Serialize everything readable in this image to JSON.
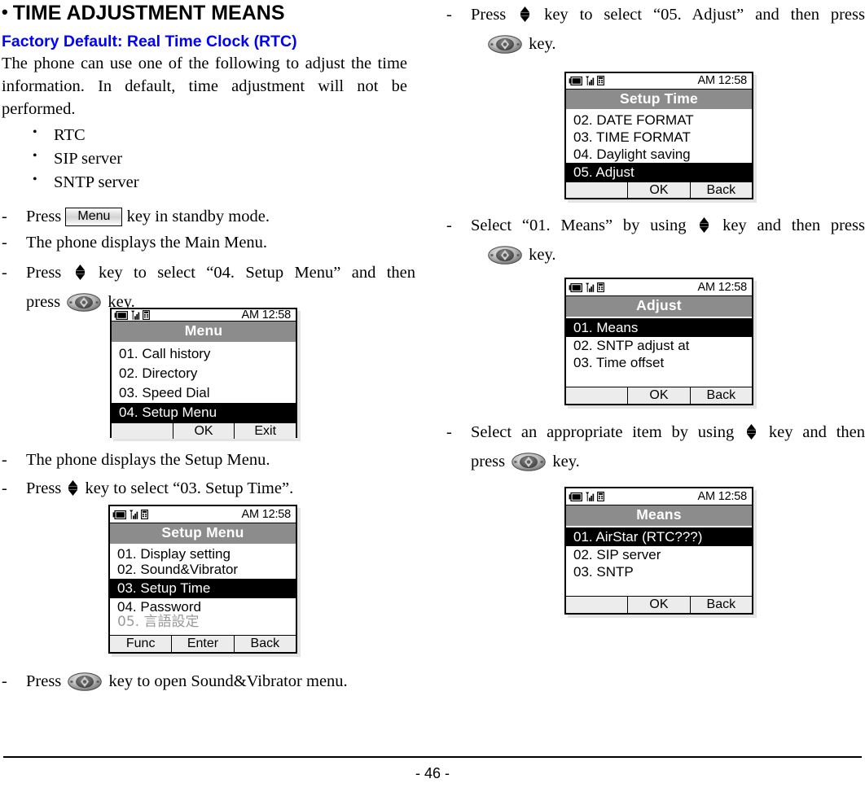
{
  "document": {
    "title": "TIME ADJUSTMENT MEANS",
    "bullet_glyph": "•",
    "subheading": "Factory Default: Real Time Clock (RTC)",
    "intro_paragraph": "The phone can use one of the following to adjust the time information. In default, time adjustment will not be performed.",
    "intro_bullets": [
      "RTC",
      "SIP server",
      "SNTP server"
    ],
    "page_number": "- 46 -"
  },
  "icons": {
    "battery": "battery-icon",
    "signal": "signal-bars-icon",
    "handset": "handset-icon",
    "updown": "up-down-arrow-key-icon",
    "navkey": "navigation-key-icon",
    "menukey": "menu-key-button"
  },
  "steps": {
    "left": [
      {
        "dash": "-",
        "parts": [
          "Press ",
          "Menu",
          " key in standby mode."
        ]
      },
      {
        "dash": "-",
        "text": "The phone displays the Main Menu."
      },
      {
        "dash": "-",
        "line1_a": "Press ",
        "line1_b": " key to select “04. Setup Menu” and then",
        "line2_a": "press ",
        "line2_b": " key."
      },
      {
        "dash": "-",
        "text": "The phone displays the Setup Menu."
      },
      {
        "dash": "-",
        "line1_a": "Press ",
        "line1_b": " key to select “03. Setup Time”."
      },
      {
        "dash": "-",
        "line1_a": "Press ",
        "line1_b": " key to open Sound&Vibrator menu."
      }
    ],
    "right": [
      {
        "dash": "-",
        "line1_a": "Press ",
        "line1_b": " key to select “05. Adjust” and then press",
        "line2_b": " key."
      },
      {
        "dash": "-",
        "line1_a": "Select “01. Means” by using ",
        "line1_b": " key and then press",
        "line2_b": " key."
      },
      {
        "dash": "-",
        "line1_a": "Select an appropriate item by using ",
        "line1_b": " key and then",
        "line2_a": "press ",
        "line2_b": " key."
      }
    ]
  },
  "screens": {
    "menu": {
      "status_time": "AM 12:58",
      "title": "Menu",
      "rows": [
        {
          "label": "01. Call history",
          "selected": false
        },
        {
          "label": "02. Directory",
          "selected": false
        },
        {
          "label": "03. Speed Dial",
          "selected": false
        },
        {
          "label": "04. Setup Menu",
          "selected": true
        }
      ],
      "softkeys": [
        "",
        "OK",
        "Exit"
      ]
    },
    "setup_menu": {
      "status_time": "AM 12:58",
      "title": "Setup Menu",
      "rows": [
        {
          "label": "01. Display setting",
          "selected": false
        },
        {
          "label": "02. Sound&Vibrator",
          "selected": false
        },
        {
          "label": "03. Setup Time",
          "selected": true
        },
        {
          "label": "04. Password",
          "selected": false
        },
        {
          "label": "05. 言語設定",
          "selected": false,
          "grayed": true
        }
      ],
      "softkeys": [
        "Func",
        "Enter",
        "Back"
      ]
    },
    "setup_time": {
      "status_time": "AM 12:58",
      "title": "Setup Time",
      "rows": [
        {
          "label": "02. DATE FORMAT",
          "selected": false
        },
        {
          "label": "03. TIME FORMAT",
          "selected": false
        },
        {
          "label": "04. Daylight saving",
          "selected": false
        },
        {
          "label": "05. Adjust",
          "selected": true
        }
      ],
      "softkeys": [
        "",
        "OK",
        "Back"
      ]
    },
    "adjust": {
      "status_time": "AM 12:58",
      "title": "Adjust",
      "rows": [
        {
          "label": "01. Means",
          "selected": true
        },
        {
          "label": "02. SNTP adjust at",
          "selected": false
        },
        {
          "label": "03. Time offset",
          "selected": false
        }
      ],
      "softkeys": [
        "",
        "OK",
        "Back"
      ]
    },
    "means": {
      "status_time": "AM 12:58",
      "title": "Means",
      "rows": [
        {
          "label": "01. AirStar (RTC???)",
          "selected": true
        },
        {
          "label": "02. SIP server",
          "selected": false
        },
        {
          "label": "03. SNTP",
          "selected": false
        }
      ],
      "softkeys": [
        "",
        "OK",
        "Back"
      ]
    }
  },
  "colors": {
    "subheading": "#0000FF",
    "lcd_title_bar": "#8C8C8C",
    "lcd_selected": "#000000",
    "lcd_softkey_bg": "#ECECEC"
  }
}
